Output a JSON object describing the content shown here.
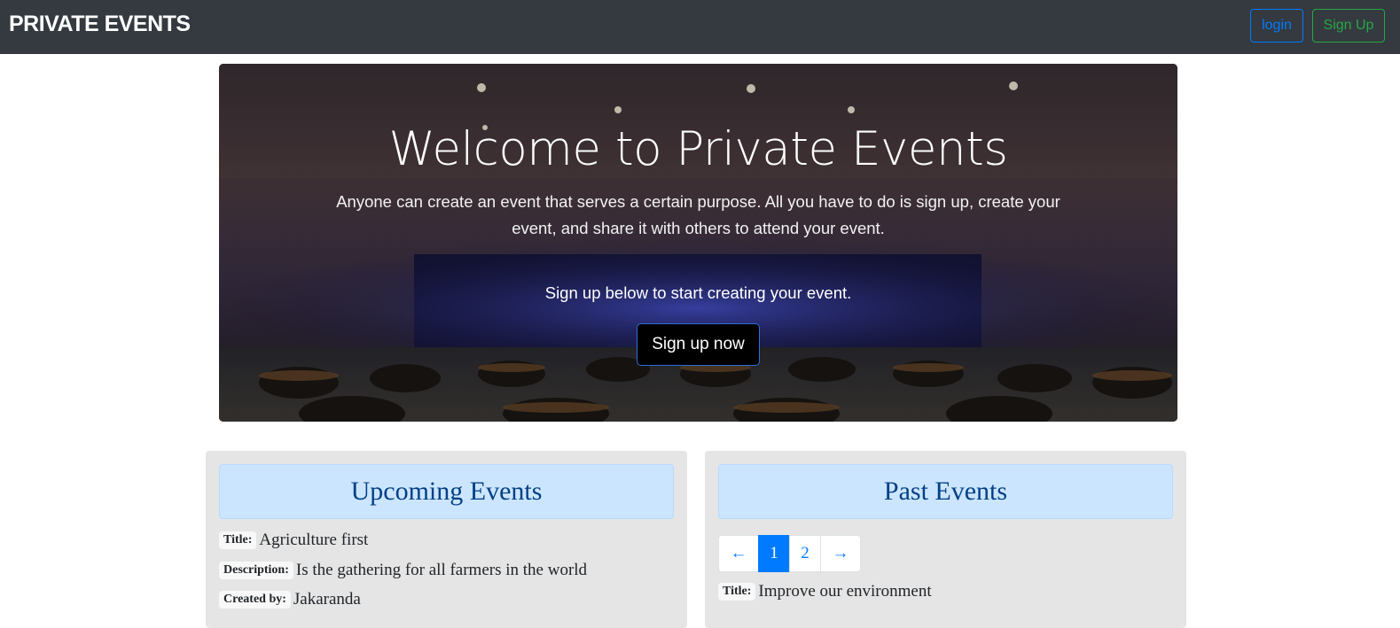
{
  "navbar": {
    "brand": "PRIVATE EVENTS",
    "login_label": "login",
    "signup_label": "Sign Up"
  },
  "hero": {
    "title": "Welcome to Private Events",
    "text": "Anyone can create an event that serves a certain purpose. All you have to do is sign up, create your event, and share it with others to attend your event.",
    "cta_text": "Sign up below to start creating your event.",
    "cta_button": "Sign up now"
  },
  "upcoming": {
    "heading": "Upcoming Events",
    "event": {
      "title_label": "Title:",
      "title": "Agriculture first",
      "description_label": "Description:",
      "description": "Is the gathering for all farmers in the world",
      "created_label": "Created by:",
      "created_by": "Jakaranda"
    }
  },
  "past": {
    "heading": "Past Events",
    "pagination": {
      "prev": "←",
      "pages": [
        "1",
        "2"
      ],
      "active": "1",
      "next": "→"
    },
    "event": {
      "title_label": "Title:",
      "title": "Improve our environment"
    }
  },
  "colors": {
    "navbar_bg": "#343a40",
    "primary": "#007bff",
    "success": "#28a745",
    "panel_header_bg": "#cce5ff",
    "panel_header_text": "#004085",
    "panel_bg": "#e5e5e5"
  }
}
